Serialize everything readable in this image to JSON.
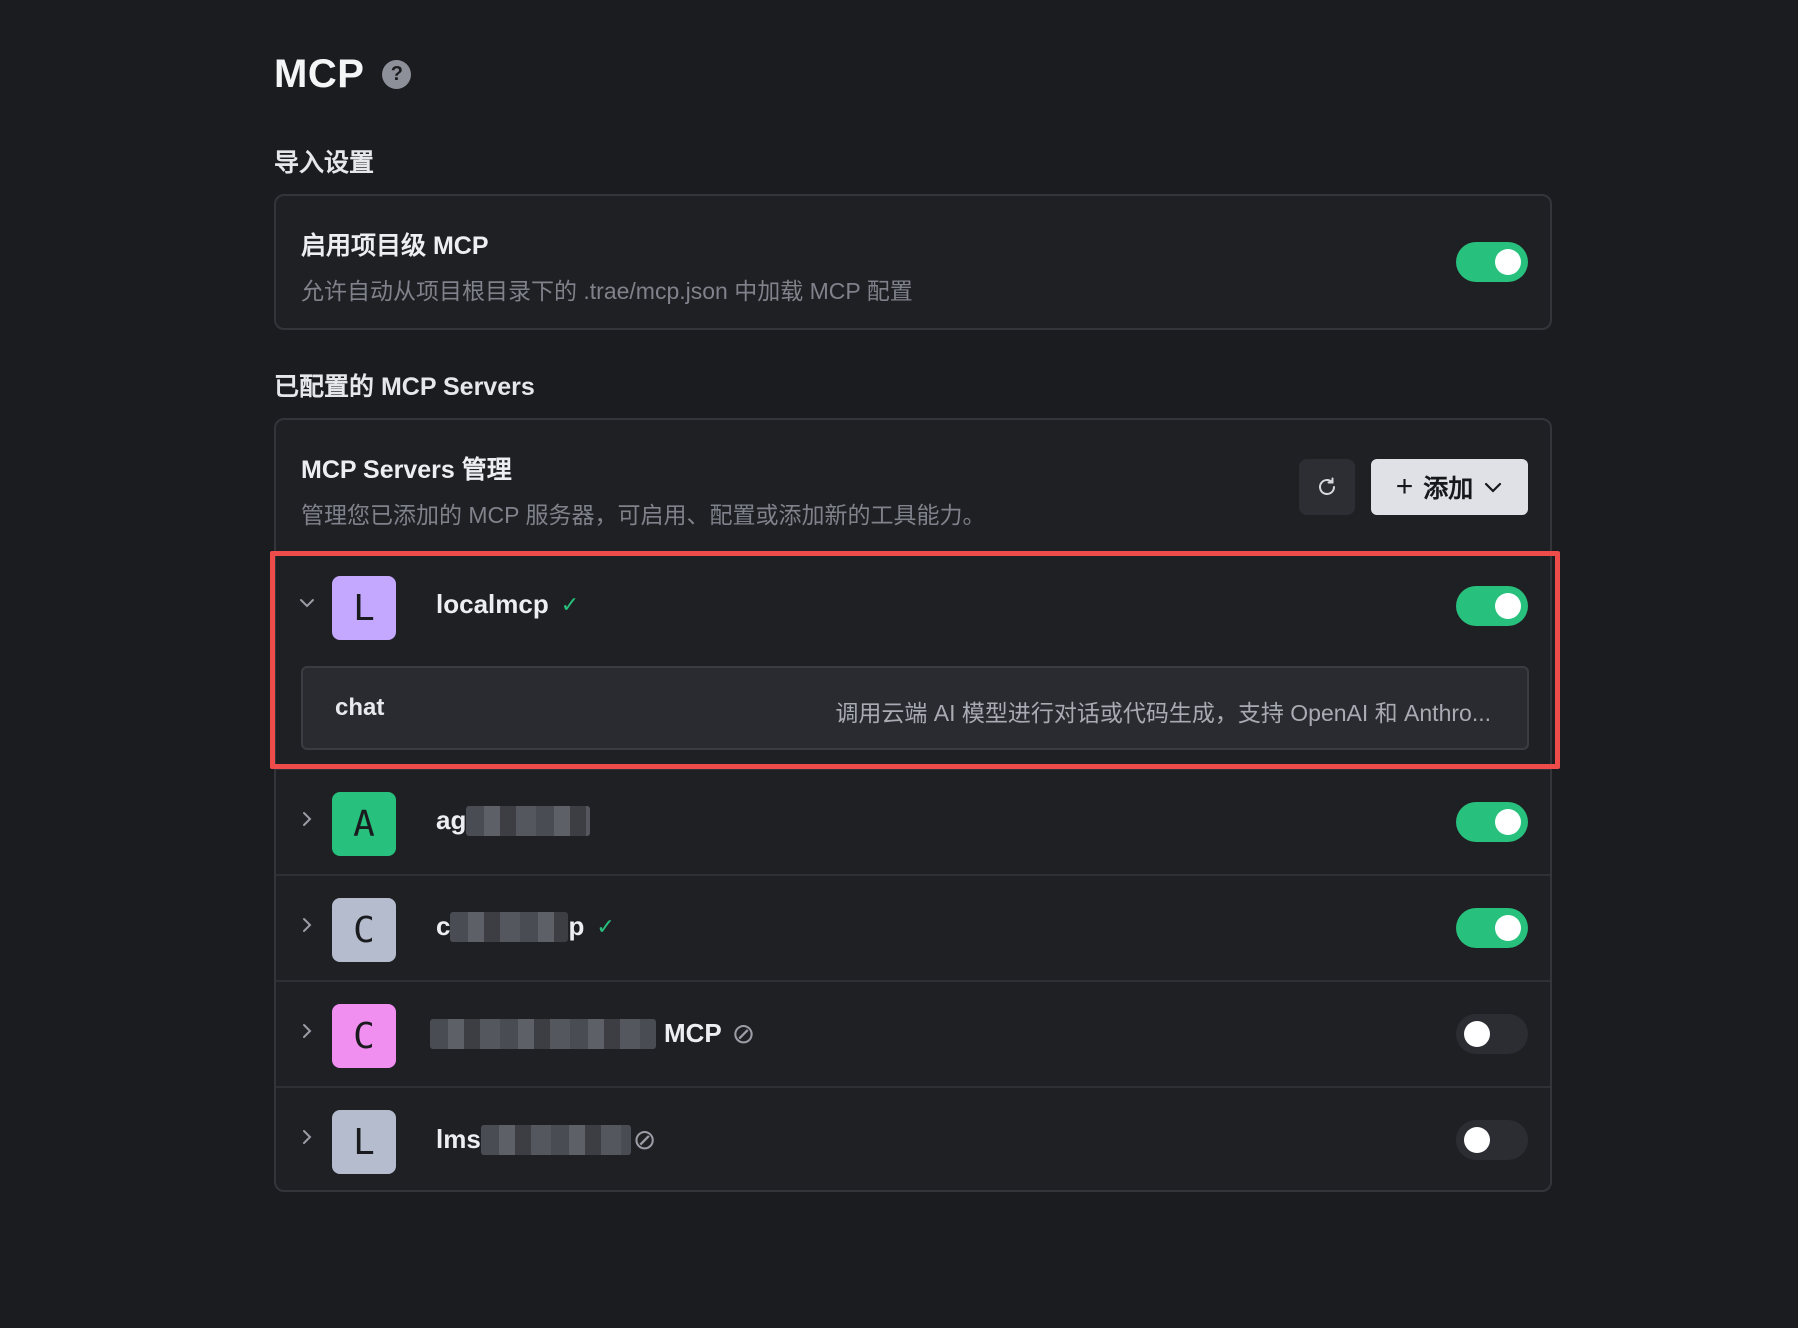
{
  "page": {
    "title": "MCP",
    "help_icon": "question-circle-icon",
    "help_symbol": "?"
  },
  "import_settings": {
    "section_label": "导入设置",
    "project_mcp": {
      "title": "启用项目级 MCP",
      "description": "允许自动从项目根目录下的 .trae/mcp.json 中加载 MCP 配置",
      "enabled": true
    }
  },
  "servers_section": {
    "section_label": "已配置的 MCP Servers",
    "management": {
      "title": "MCP Servers 管理",
      "description": "管理您已添加的 MCP 服务器，可启用、配置或添加新的工具能力。",
      "refresh_icon": "refresh-icon",
      "add_button": {
        "plus": "+",
        "label": "添加"
      }
    },
    "servers": [
      {
        "initial": "L",
        "name_prefix": "localmcp",
        "name_suffix": "",
        "status": "ok",
        "status_symbol": "✓",
        "enabled": true,
        "expanded": true,
        "avatar_color": "#c4a8ff",
        "tools": [
          {
            "name": "chat",
            "description": "调用云端 AI 模型进行对话或代码生成，支持 OpenAI 和 Anthro..."
          }
        ]
      },
      {
        "initial": "A",
        "name_prefix": "ag",
        "name_suffix": "",
        "status": "none",
        "status_symbol": "",
        "enabled": true,
        "expanded": false,
        "avatar_color": "#27c07d"
      },
      {
        "initial": "C",
        "name_prefix": "c",
        "name_suffix": "p",
        "status": "ok",
        "status_symbol": "✓",
        "enabled": true,
        "expanded": false,
        "avatar_color": "#b4bccd"
      },
      {
        "initial": "C",
        "name_prefix": "",
        "name_suffix": "MCP",
        "status": "disabled",
        "status_symbol": "⊘",
        "enabled": false,
        "expanded": false,
        "avatar_color": "#f08ff0"
      },
      {
        "initial": "L",
        "name_prefix": "lms",
        "name_suffix": "",
        "status": "disabled",
        "status_symbol": "⊘",
        "enabled": false,
        "expanded": false,
        "avatar_color": "#b4bccd"
      }
    ]
  },
  "colors": {
    "accent_green": "#27c07d",
    "highlight_red": "#ee4b4b",
    "background": "#1b1c1f"
  }
}
